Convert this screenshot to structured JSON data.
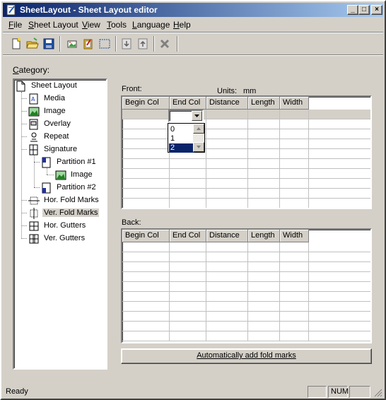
{
  "window": {
    "title": "SheetLayout - Sheet Layout editor",
    "caption_buttons": {
      "minimize": "_",
      "maximize": "□",
      "close": "×"
    }
  },
  "menu": [
    {
      "label": "File",
      "accel": "F",
      "rest": "ile"
    },
    {
      "label": "Sheet Layout",
      "accel": "S",
      "rest": "heet Layout"
    },
    {
      "label": "View",
      "accel": "V",
      "rest": "iew"
    },
    {
      "label": "Tools",
      "accel": "T",
      "rest": "ools"
    },
    {
      "label": "Language",
      "accel": "L",
      "rest": "anguage"
    },
    {
      "label": "Help",
      "accel": "H",
      "rest": "elp"
    }
  ],
  "toolbar": {
    "icons": [
      "new-document-icon",
      "open-folder-icon",
      "save-icon",
      "image-icon",
      "clipboard-icon",
      "rectangle-select-icon",
      "move-down-icon",
      "move-up-icon",
      "delete-icon"
    ]
  },
  "category": {
    "label_accel": "C",
    "label_rest": "ategory:",
    "tree": [
      {
        "label": "Sheet Layout",
        "icon": "page-icon"
      },
      {
        "label": "Media",
        "icon": "media-icon"
      },
      {
        "label": "Image",
        "icon": "image-icon"
      },
      {
        "label": "Overlay",
        "icon": "overlay-icon"
      },
      {
        "label": "Repeat",
        "icon": "repeat-icon"
      },
      {
        "label": "Signature",
        "icon": "signature-icon"
      },
      {
        "label": "Partition #1",
        "icon": "partition-icon"
      },
      {
        "label": "Image",
        "icon": "image-icon"
      },
      {
        "label": "Partition #2",
        "icon": "partition-icon"
      },
      {
        "label": "Hor. Fold Marks",
        "icon": "hor-fold-marks-icon"
      },
      {
        "label": "Ver. Fold Marks",
        "icon": "ver-fold-marks-icon",
        "selected": true
      },
      {
        "label": "Hor. Gutters",
        "icon": "hor-gutters-icon"
      },
      {
        "label": "Ver. Gutters",
        "icon": "ver-gutters-icon"
      }
    ]
  },
  "front": {
    "label": "Front:",
    "units_label": "Units:",
    "units_value": "mm",
    "columns": [
      "Begin Col",
      "End Col",
      "Distance",
      "Length",
      "Width"
    ],
    "dropdown_options": [
      "0",
      "1",
      "2"
    ],
    "dropdown_selected": "2"
  },
  "back": {
    "label": "Back:",
    "columns": [
      "Begin Col",
      "End Col",
      "Distance",
      "Length",
      "Width"
    ]
  },
  "auto_button": {
    "label": "Automatically add fold marks"
  },
  "statusbar": {
    "text": "Ready",
    "panels": [
      "",
      "NUM",
      ""
    ]
  },
  "colors": {
    "face": "#d4d0c8",
    "title_start": "#0a246a",
    "title_end": "#a6caf0",
    "selection": "#0a246a"
  }
}
